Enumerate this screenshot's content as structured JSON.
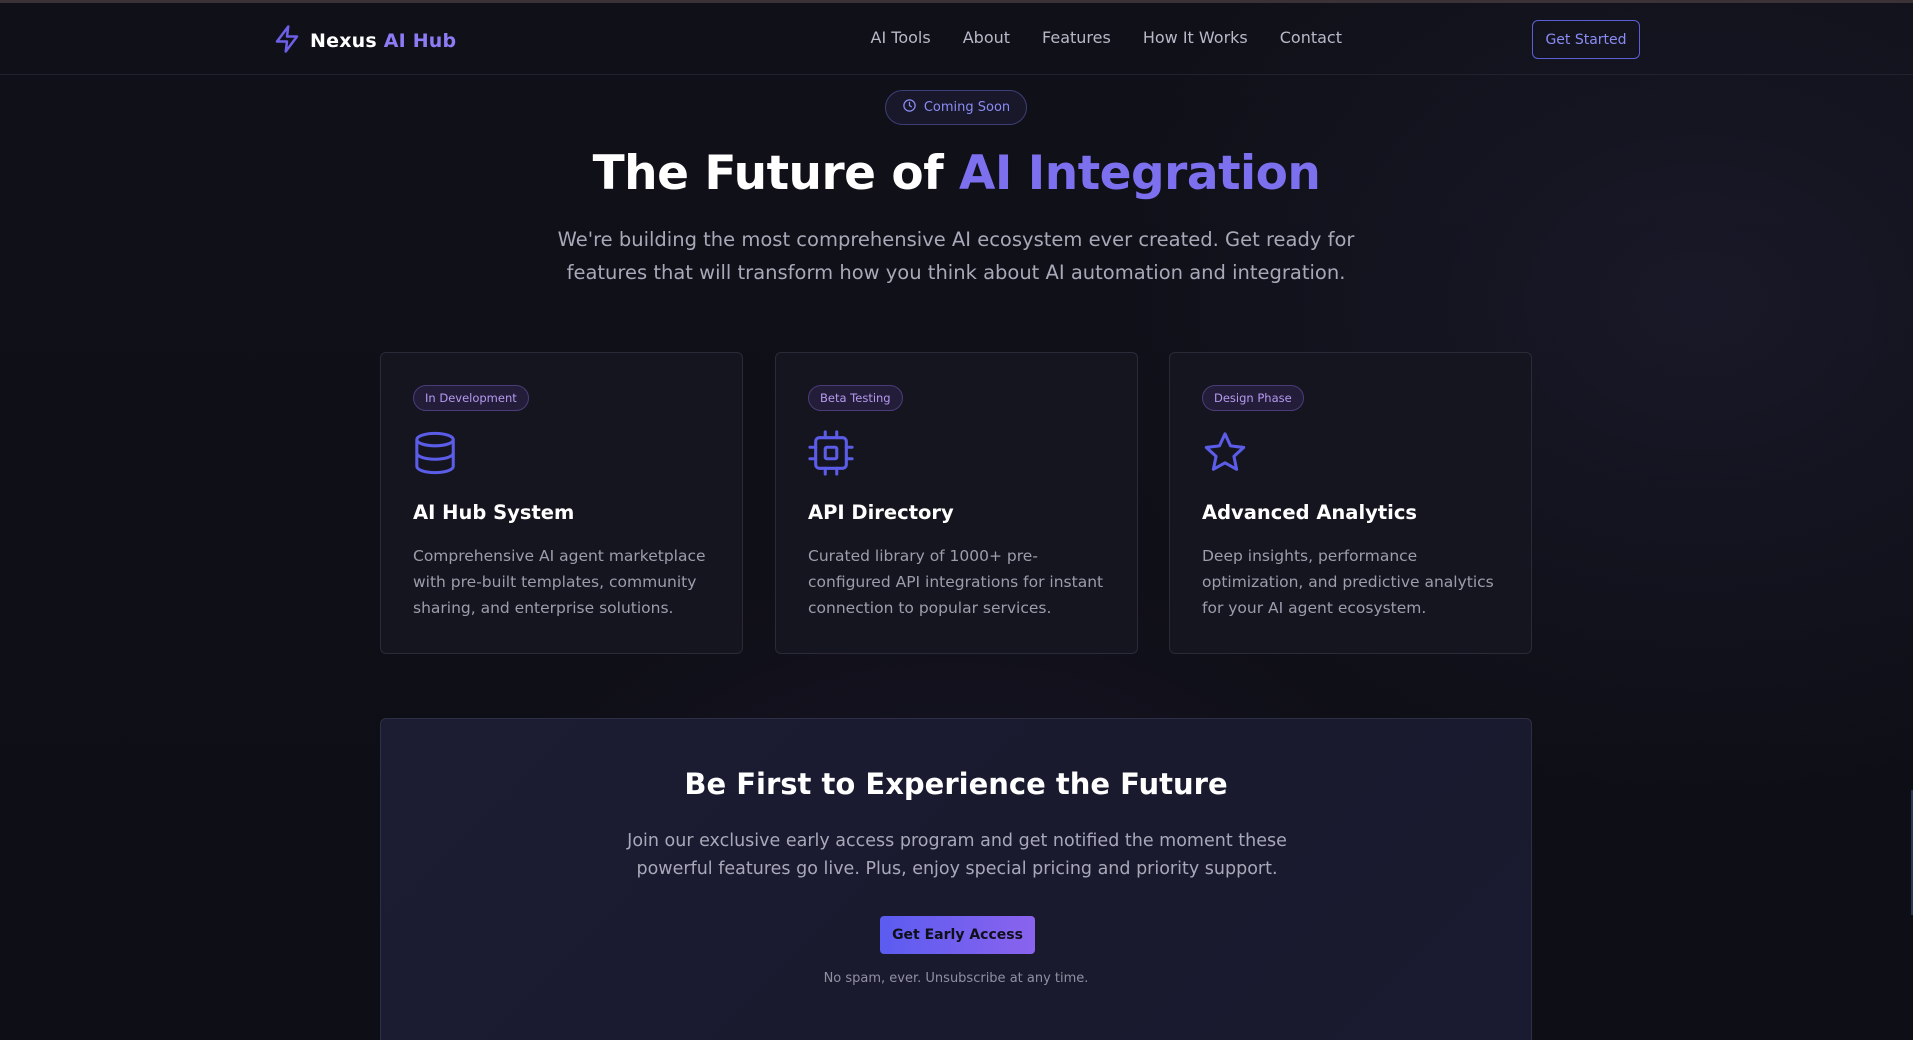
{
  "brand": {
    "name": "Nexus",
    "accent": "AI Hub"
  },
  "nav": {
    "items": [
      "AI Tools",
      "About",
      "Features",
      "How It Works",
      "Contact"
    ],
    "cta": "Get Started"
  },
  "hero": {
    "badge": "Coming Soon",
    "title_plain": "The Future of ",
    "title_accent": "AI Integration",
    "subtitle": "We're building the most comprehensive AI ecosystem ever created. Get ready for features that will transform how you think about AI automation and integration."
  },
  "cards": [
    {
      "tag": "In Development",
      "icon": "database-icon",
      "title": "AI Hub System",
      "description": "Comprehensive AI agent marketplace with pre-built templates, community sharing, and enterprise solutions."
    },
    {
      "tag": "Beta Testing",
      "icon": "cpu-icon",
      "title": "API Directory",
      "description": "Curated library of 1000+ pre-configured API integrations for instant connection to popular services."
    },
    {
      "tag": "Design Phase",
      "icon": "star-icon",
      "title": "Advanced Analytics",
      "description": "Deep insights, performance optimization, and predictive analytics for your AI agent ecosystem."
    }
  ],
  "cta": {
    "title": "Be First to Experience the Future",
    "lead": "Join our exclusive early access program and get notified the moment these powerful features go live. Plus, enjoy special pricing and priority support.",
    "button": "Get Early Access",
    "note": "No spam, ever. Unsubscribe at any time."
  },
  "colors": {
    "background": "#0f0f17",
    "accent": "#7c70ef",
    "primary_button": "#5b5cf0",
    "card_bg": "#15151f"
  }
}
